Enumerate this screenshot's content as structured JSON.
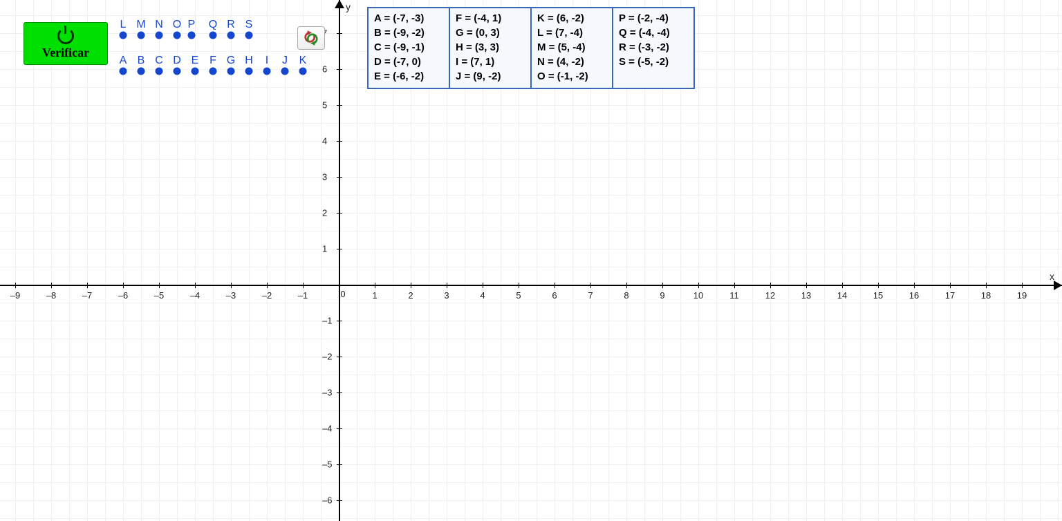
{
  "ui": {
    "verify_label": "Verificar",
    "reset_name": "reset"
  },
  "axes": {
    "x_label": "x",
    "y_label": "y",
    "origin_label": "0",
    "x_ticks": [
      "–9",
      "–8",
      "–7",
      "–6",
      "–5",
      "–4",
      "–3",
      "–2",
      "–1",
      "0",
      "1",
      "2",
      "3",
      "4",
      "5",
      "6",
      "7",
      "8",
      "9",
      "10",
      "11",
      "12",
      "13",
      "14",
      "15",
      "16",
      "17",
      "18",
      "19"
    ],
    "y_ticks_pos": [
      "1",
      "2",
      "3",
      "4",
      "5",
      "6",
      "7"
    ],
    "y_ticks_neg": [
      "–1",
      "–2",
      "–3",
      "–4",
      "–5",
      "–6"
    ]
  },
  "points_row2": [
    {
      "l": "A",
      "vx": -6
    },
    {
      "l": "B",
      "vx": -5.5
    },
    {
      "l": "C",
      "vx": -5
    },
    {
      "l": "D",
      "vx": -4.5
    },
    {
      "l": "E",
      "vx": -4
    },
    {
      "l": "F",
      "vx": -3.5
    },
    {
      "l": "G",
      "vx": -3
    },
    {
      "l": "H",
      "vx": -2.5
    },
    {
      "l": "I",
      "vx": -2
    },
    {
      "l": "J",
      "vx": -1.5
    },
    {
      "l": "K",
      "vx": -1
    }
  ],
  "points_row1": [
    {
      "l": "L",
      "vx": -6
    },
    {
      "l": "M",
      "vx": -5.5
    },
    {
      "l": "N",
      "vx": -5
    },
    {
      "l": "O",
      "vx": -4.5
    },
    {
      "l": "P",
      "vx": -4.1
    },
    {
      "l": "Q",
      "vx": -3.5
    },
    {
      "l": "R",
      "vx": -3
    },
    {
      "l": "S",
      "vx": -2.5
    }
  ],
  "targets": {
    "col1": [
      "A = (-7, -3)",
      "B = (-9, -2)",
      "C = (-9, -1)",
      "D = (-7, 0)",
      "E = (-6, -2)"
    ],
    "col2": [
      "F = (-4, 1)",
      "G = (0, 3)",
      "H = (3, 3)",
      "I = (7, 1)",
      "J = (9, -2)"
    ],
    "col3": [
      "K = (6, -2)",
      "L = (7, -4)",
      "M = (5, -4)",
      "N = (4, -2)",
      "O = (-1, -2)"
    ],
    "col4": [
      "P = (-2, -4)",
      "Q = (-4, -4)",
      "R = (-3, -2)",
      "S = (-5, -2)"
    ]
  }
}
